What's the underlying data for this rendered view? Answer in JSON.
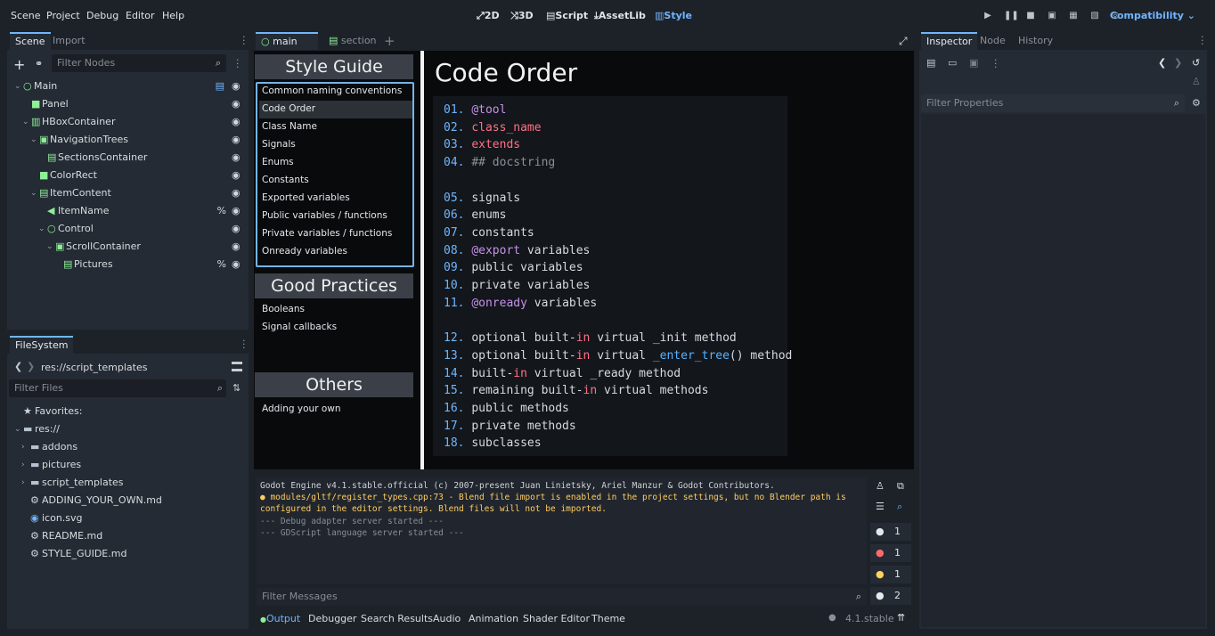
{
  "menu": [
    "Scene",
    "Project",
    "Debug",
    "Editor",
    "Help"
  ],
  "workspaces": [
    {
      "label": "2D",
      "icon": "2d-icon",
      "active": false
    },
    {
      "label": "3D",
      "icon": "3d-icon",
      "active": false
    },
    {
      "label": "Script",
      "icon": "script-icon",
      "active": false
    },
    {
      "label": "AssetLib",
      "icon": "assetlib-icon",
      "active": false
    },
    {
      "label": "Style",
      "icon": "style-icon",
      "active": true
    }
  ],
  "renderer": "Compatibility",
  "scene_dock": {
    "tabs": [
      "Scene",
      "Import"
    ],
    "filter_placeholder": "Filter Nodes",
    "nodes": [
      {
        "label": "Main",
        "color": "#8eef97",
        "script": true
      },
      {
        "label": "Panel",
        "color": "#8eef97"
      },
      {
        "label": "HBoxContainer",
        "color": "#8eef97"
      },
      {
        "label": "NavigationTrees",
        "color": "#8eef97"
      },
      {
        "label": "SectionsContainer",
        "color": "#8eef97"
      },
      {
        "label": "ColorRect",
        "color": "#8eef97"
      },
      {
        "label": "ItemContent",
        "color": "#8eef97"
      },
      {
        "label": "ItemName",
        "color": "#8eef97",
        "pct": "%"
      },
      {
        "label": "Control",
        "color": "#8eef97"
      },
      {
        "label": "ScrollContainer",
        "color": "#8eef97"
      },
      {
        "label": "Pictures",
        "color": "#8eef97",
        "pct": "%"
      }
    ]
  },
  "filesystem_dock": {
    "tab": "FileSystem",
    "path": "res://script_templates",
    "filter_placeholder": "Filter Files",
    "items": [
      {
        "label": "Favorites:",
        "kind": "favorites"
      },
      {
        "label": "res://",
        "kind": "root"
      },
      {
        "label": "addons",
        "kind": "folder"
      },
      {
        "label": "pictures",
        "kind": "folder"
      },
      {
        "label": "script_templates",
        "kind": "folder"
      },
      {
        "label": "ADDING_YOUR_OWN.md",
        "kind": "file"
      },
      {
        "label": "icon.svg",
        "kind": "image"
      },
      {
        "label": "README.md",
        "kind": "file"
      },
      {
        "label": "STYLE_GUIDE.md",
        "kind": "file"
      }
    ]
  },
  "editor_tabs": [
    {
      "label": "main",
      "active": true
    },
    {
      "label": "section",
      "active": false
    }
  ],
  "viewport": {
    "sections": [
      {
        "header": "Style Guide",
        "items": [
          "Common naming conventions",
          "Code Order",
          "Class Name",
          "Signals",
          "Enums",
          "Constants",
          "Exported variables",
          "Public variables / functions",
          "Private variables / functions",
          "Onready variables"
        ]
      },
      {
        "header": "Good Practices",
        "items": [
          "Booleans",
          "Signal callbacks"
        ]
      },
      {
        "header": "Others",
        "items": [
          "Adding your own"
        ]
      }
    ],
    "selected_item": "Code Order",
    "content_title": "Code Order",
    "code_lines": [
      {
        "n": "01.",
        "parts": [
          [
            "ann",
            "@tool"
          ]
        ]
      },
      {
        "n": "02.",
        "parts": [
          [
            "kw",
            "class_name"
          ]
        ]
      },
      {
        "n": "03.",
        "parts": [
          [
            "kw",
            "extends"
          ]
        ]
      },
      {
        "n": "04.",
        "parts": [
          [
            "cm",
            "## docstring"
          ]
        ]
      },
      {
        "n": "",
        "parts": []
      },
      {
        "n": "05.",
        "parts": [
          [
            "",
            "signals"
          ]
        ]
      },
      {
        "n": "06.",
        "parts": [
          [
            "",
            "enums"
          ]
        ]
      },
      {
        "n": "07.",
        "parts": [
          [
            "",
            "constants"
          ]
        ]
      },
      {
        "n": "08.",
        "parts": [
          [
            "ann",
            "@export"
          ],
          [
            "",
            " variables"
          ]
        ]
      },
      {
        "n": "09.",
        "parts": [
          [
            "",
            "public variables"
          ]
        ]
      },
      {
        "n": "10.",
        "parts": [
          [
            "",
            "private variables"
          ]
        ]
      },
      {
        "n": "11.",
        "parts": [
          [
            "ann",
            "@onready"
          ],
          [
            "",
            " variables"
          ]
        ]
      },
      {
        "n": "",
        "parts": []
      },
      {
        "n": "12.",
        "parts": [
          [
            "",
            "optional built-"
          ],
          [
            "kw",
            "in"
          ],
          [
            "",
            " virtual _init method"
          ]
        ]
      },
      {
        "n": "13.",
        "parts": [
          [
            "",
            "optional built-"
          ],
          [
            "kw",
            "in"
          ],
          [
            "",
            " virtual "
          ],
          [
            "fn",
            "_enter_tree"
          ],
          [
            "",
            "() method"
          ]
        ]
      },
      {
        "n": "14.",
        "parts": [
          [
            "",
            "built-"
          ],
          [
            "kw",
            "in"
          ],
          [
            "",
            " virtual _ready method"
          ]
        ]
      },
      {
        "n": "15.",
        "parts": [
          [
            "",
            "remaining built-"
          ],
          [
            "kw",
            "in"
          ],
          [
            "",
            " virtual methods"
          ]
        ]
      },
      {
        "n": "16.",
        "parts": [
          [
            "",
            "public methods"
          ]
        ]
      },
      {
        "n": "17.",
        "parts": [
          [
            "",
            "private methods"
          ]
        ]
      },
      {
        "n": "18.",
        "parts": [
          [
            "",
            "subclasses"
          ]
        ]
      }
    ]
  },
  "output": {
    "lines": [
      {
        "style": "normal",
        "text": "Godot Engine v4.1.stable.official (c) 2007-present Juan Linietsky, Ariel Manzur & Godot Contributors."
      },
      {
        "style": "warn",
        "text": "● modules/gltf/register_types.cpp:73 - Blend file import is enabled in the project settings, but no Blender path is"
      },
      {
        "style": "warn",
        "text": "configured in the editor settings. Blend files will not be imported."
      },
      {
        "style": "dim",
        "text": "--- Debug adapter server started ---"
      },
      {
        "style": "dim",
        "text": "--- GDScript language server started ---"
      }
    ],
    "filter_placeholder": "Filter Messages",
    "counters": [
      {
        "icon": "message-icon",
        "count": "1",
        "color": "#e6e9ec"
      },
      {
        "icon": "error-icon",
        "count": "1",
        "color": "#ff6b6b"
      },
      {
        "icon": "warning-icon",
        "count": "1",
        "color": "#ffd35a"
      },
      {
        "icon": "info-icon",
        "count": "2",
        "color": "#e6e9ec"
      }
    ],
    "bottom_tabs": [
      "Output",
      "Debugger",
      "Search Results",
      "Audio",
      "Animation",
      "Shader Editor",
      "Theme"
    ],
    "version": "4.1.stable"
  },
  "inspector": {
    "tabs": [
      "Inspector",
      "Node",
      "History"
    ],
    "filter_placeholder": "Filter Properties"
  }
}
